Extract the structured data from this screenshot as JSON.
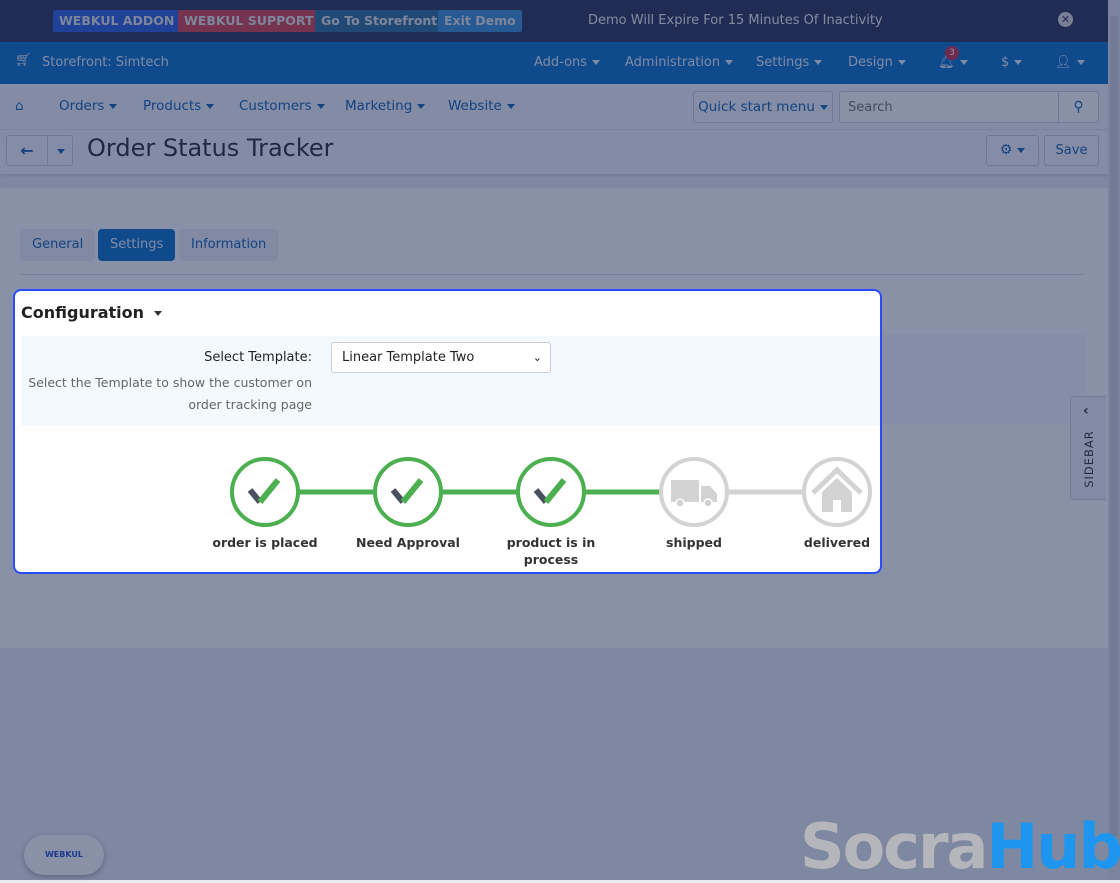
{
  "topbar": {
    "buttons": [
      {
        "label": "WEBKUL ADDON",
        "color": "#2a5fe0"
      },
      {
        "label": "WEBKUL SUPPORT",
        "color": "#d9434f"
      },
      {
        "label": "Go To Storefront",
        "color": "#2f6f9a"
      },
      {
        "label": "Exit Demo",
        "color": "#3a8fd6"
      }
    ],
    "message": "Demo Will Expire For 15 Minutes Of Inactivity"
  },
  "header": {
    "storefront": "Storefront: Simtech",
    "menu": [
      "Add-ons",
      "Administration",
      "Settings",
      "Design"
    ],
    "notifications": "3",
    "currency": "$"
  },
  "nav": {
    "items": [
      "Orders",
      "Products",
      "Customers",
      "Marketing",
      "Website"
    ],
    "quick_start": "Quick start menu",
    "search_placeholder": "Search"
  },
  "page": {
    "title": "Order Status Tracker",
    "save": "Save"
  },
  "tabs": [
    {
      "label": "General",
      "active": false
    },
    {
      "label": "Settings",
      "active": true
    },
    {
      "label": "Information",
      "active": false
    }
  ],
  "config": {
    "heading": "Configuration",
    "select_label": "Select Template:",
    "select_value": "Linear Template Two",
    "help": "Select the Template to show the customer on order tracking page"
  },
  "tracker": {
    "steps": [
      {
        "label": "order is placed",
        "done": true,
        "icon": "check-icon"
      },
      {
        "label": "Need Approval",
        "done": true,
        "icon": "check-icon"
      },
      {
        "label": "product is in process",
        "done": true,
        "icon": "check-icon"
      },
      {
        "label": "shipped",
        "done": false,
        "icon": "truck-icon"
      },
      {
        "label": "delivered",
        "done": false,
        "icon": "home-icon"
      }
    ],
    "done_color": "#4caf50",
    "pending_color": "#d3d3d3"
  },
  "sidebar": {
    "label": "SIDEBAR"
  },
  "footer": {
    "webkul": "WEBKUL",
    "watermark_a": "Socra",
    "watermark_b": "Hub"
  }
}
